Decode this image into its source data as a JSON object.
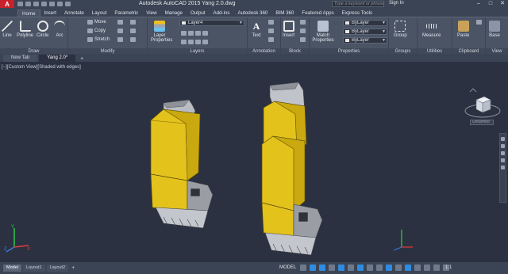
{
  "title_bar": {
    "app_logo": "A",
    "title": "Autodesk AutoCAD 2015    Yang 2.0.dwg",
    "search_placeholder": "Type a keyword or phrase",
    "sign_in": "Sign In",
    "minimize": "–",
    "maximize": "□",
    "close": "✕"
  },
  "ribbon_tabs": [
    {
      "label": "Home",
      "active": true
    },
    {
      "label": "Insert"
    },
    {
      "label": "Annotate"
    },
    {
      "label": "Layout"
    },
    {
      "label": "Parametric"
    },
    {
      "label": "View"
    },
    {
      "label": "Manage"
    },
    {
      "label": "Output"
    },
    {
      "label": "Add-ins"
    },
    {
      "label": "Autodesk 360"
    },
    {
      "label": "BIM 360"
    },
    {
      "label": "Featured Apps"
    },
    {
      "label": "Express Tools"
    }
  ],
  "ribbon": {
    "draw": {
      "title": "Draw",
      "line": "Line",
      "polyline": "Polyline",
      "circle": "Circle",
      "arc": "Arc"
    },
    "modify": {
      "title": "Modify",
      "move": "Move",
      "copy": "Copy",
      "stretch": "Stretch"
    },
    "layers": {
      "title": "Layers",
      "layer_properties": "Layer Properties",
      "current_layer": "Layer4"
    },
    "annotation": {
      "title": "Annotation",
      "text": "Text"
    },
    "block": {
      "title": "Block",
      "insert": "Insert"
    },
    "properties": {
      "title": "Properties",
      "match_properties": "Match Properties",
      "color": "ByLayer",
      "linetype": "ByLayer",
      "lineweight": "ByLayer"
    },
    "groups": {
      "title": "Groups",
      "group": "Group"
    },
    "utilities": {
      "title": "Utilities",
      "measure": "Measure"
    },
    "clipboard": {
      "title": "Clipboard",
      "paste": "Paste"
    },
    "view": {
      "title": "View",
      "base": "Base"
    }
  },
  "doc_tabs": [
    {
      "label": "New Tab"
    },
    {
      "label": "Yang 2.0*",
      "active": true
    }
  ],
  "viewport": {
    "label": "[−][Custom View][Shaded with edges]",
    "named_view": "Unnamed",
    "model_color": "#e3c21c"
  },
  "layout_tabs": [
    {
      "label": "Model",
      "active": true
    },
    {
      "label": "Layout1"
    },
    {
      "label": "Layout2"
    }
  ],
  "status_bar": {
    "space": "MODEL",
    "scale": "1:1"
  }
}
